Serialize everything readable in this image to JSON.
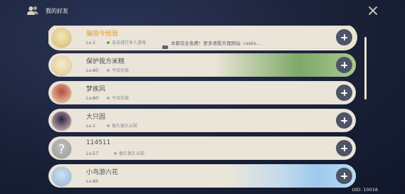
{
  "header": {
    "title": "我的好友"
  },
  "friends": [
    {
      "name": "骗指令给我",
      "level": "Lv.1",
      "status": "无法进行多人游戏",
      "status_color": "#4cae4f",
      "signature": "本服完全免费！更多请看天理网站: casks...",
      "highlight": true,
      "deco": "none",
      "avatar_colors": [
        "#f3e6b8",
        "#d9b96e"
      ]
    },
    {
      "name": "保护我方米糕",
      "level": "Lv.60",
      "status": "今日在线",
      "status_color": "#a8acb7",
      "signature": "",
      "highlight": false,
      "deco": "green",
      "avatar_colors": [
        "#f5ebcf",
        "#e0c88a"
      ]
    },
    {
      "name": "梦疾风",
      "level": "Lv.60",
      "status": "今日在线",
      "status_color": "#a8acb7",
      "signature": "",
      "highlight": false,
      "deco": "none",
      "avatar_colors": [
        "#b44b3a",
        "#f2d7b5"
      ]
    },
    {
      "name": "大只因",
      "level": "Lv.1",
      "status": "很久很久以前",
      "status_color": "#a8acb7",
      "signature": "",
      "highlight": false,
      "deco": "none",
      "avatar_colors": [
        "#2a2340",
        "#e8c7c7"
      ]
    },
    {
      "name": "114511",
      "level": "Lv.57",
      "status": "很久很久以前",
      "status_color": "#a8acb7",
      "signature": "",
      "highlight": false,
      "deco": "none",
      "avatar_colors": [
        "#bfbfbf",
        "#9a9a9a"
      ]
    },
    {
      "name": "小鸟游六花",
      "level": "Lv.60",
      "status": "",
      "status_color": "#a8acb7",
      "signature": "",
      "highlight": false,
      "deco": "blue",
      "avatar_colors": [
        "#cfe2f5",
        "#8fb2d9"
      ]
    }
  ],
  "footer": {
    "uid": "UID: 10016"
  }
}
